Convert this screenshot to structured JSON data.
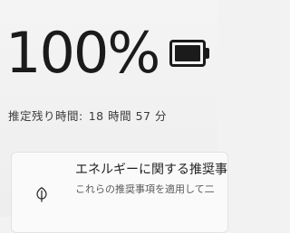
{
  "battery": {
    "percent_text": "100%",
    "charge_level": 1.0,
    "remaining_label": "推定残り時間:",
    "remaining_value": "18 時間 57 分"
  },
  "recommendations": {
    "title": "エネルギーに関する推奨事",
    "description": "これらの推奨事項を適用して二"
  },
  "icons": {
    "battery": "battery-full-icon",
    "leaf": "leaf-icon"
  },
  "colors": {
    "text": "#1b1b1b",
    "muted": "#5a5a5a",
    "background": "#f2f2f2"
  }
}
